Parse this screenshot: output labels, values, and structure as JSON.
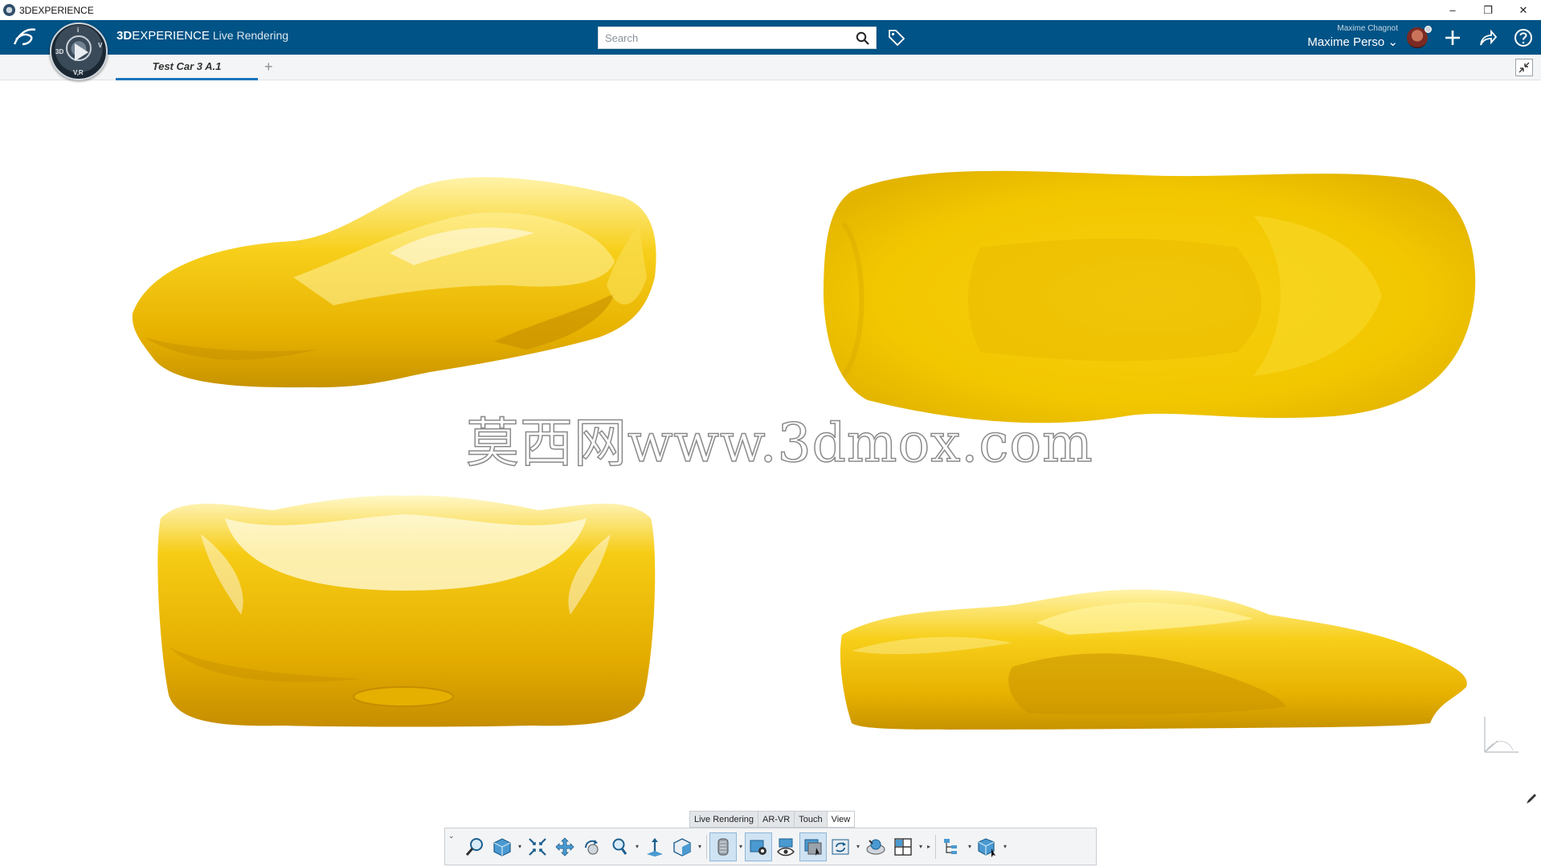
{
  "window": {
    "title": "3DEXPERIENCE",
    "controls": [
      "–",
      "❐",
      "✕"
    ]
  },
  "topbar": {
    "brand_bold": "3D",
    "brand_rest": "EXPERIENCE",
    "app_name": "Live Rendering",
    "search_placeholder": "Search",
    "user_small": "Maxime Chagnot",
    "user_name": "Maxime Perso ⌄",
    "compass_labels": {
      "top": "i",
      "left": "3D",
      "right": "V",
      "bottom": "V,R"
    }
  },
  "tabs": {
    "items": [
      {
        "label": "Test Car 3 A.1",
        "active": true
      }
    ],
    "add_label": "+"
  },
  "watermark": "莫西网www.3dmox.com",
  "bottom_tabs": [
    {
      "label": "Live Rendering",
      "active": false
    },
    {
      "label": "AR-VR",
      "active": false
    },
    {
      "label": "Touch",
      "active": false
    },
    {
      "label": "View",
      "active": true
    }
  ],
  "action_bar": {
    "expander": "⌄",
    "tools": [
      {
        "icon": "zoom-area-icon"
      },
      {
        "icon": "view-cube-icon",
        "caret": true
      },
      {
        "icon": "fit-all-icon"
      },
      {
        "icon": "pan-icon"
      },
      {
        "icon": "rotate-icon"
      },
      {
        "icon": "zoom-icon",
        "caret": true
      },
      {
        "icon": "normal-view-icon"
      },
      {
        "icon": "iso-view-icon",
        "caret": true
      },
      {
        "icon": "render-style-icon",
        "caret": true,
        "selected": true
      },
      {
        "icon": "lighting-icon",
        "selected": true
      },
      {
        "icon": "hide-show-icon"
      },
      {
        "icon": "swap-visible-icon",
        "selected": true
      },
      {
        "icon": "refresh-view-icon",
        "caret": true
      },
      {
        "icon": "environment-icon"
      },
      {
        "icon": "multi-view-icon",
        "caret": true
      },
      {
        "icon": "more-arrow-icon"
      },
      {
        "icon": "tree-icon",
        "caret": true
      },
      {
        "icon": "model-cube-icon",
        "caret": true
      }
    ]
  },
  "colors": {
    "topbar": "#005386",
    "car_yellow": "#f2c200",
    "car_highlight": "#fff2a0",
    "car_shadow": "#d39a00",
    "tab_underline": "#1b75bb"
  }
}
